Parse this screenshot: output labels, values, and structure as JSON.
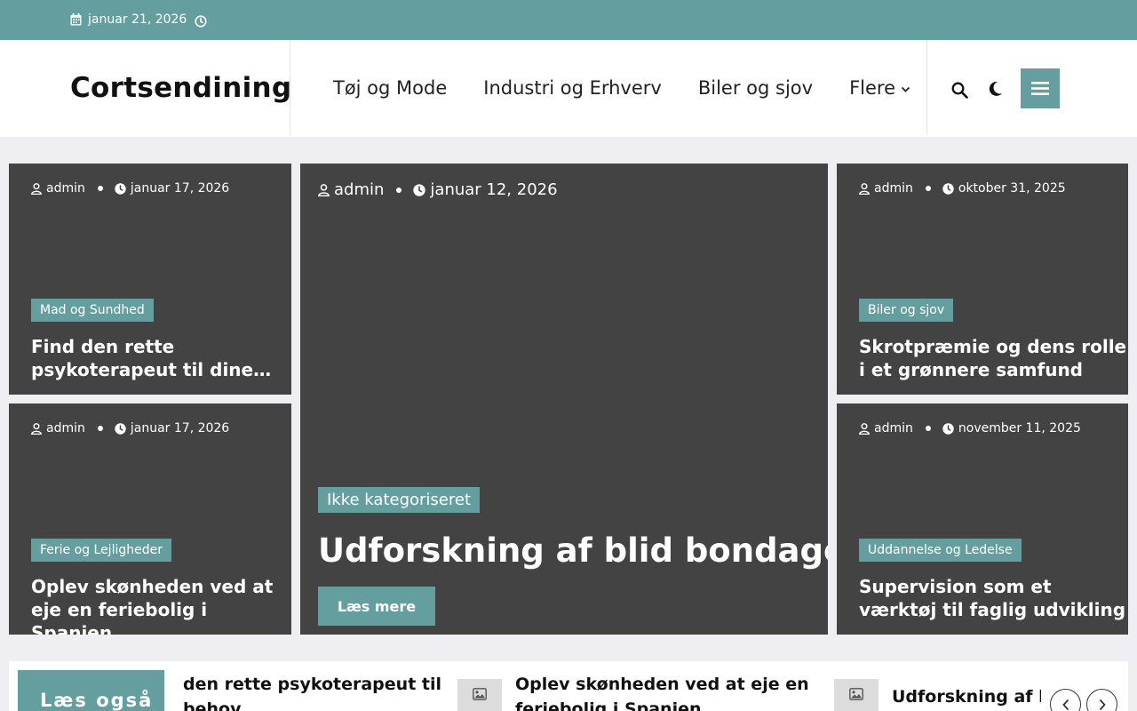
{
  "topbar": {
    "date": "januar 21, 2026"
  },
  "header": {
    "logo": "Cortsendining",
    "nav": [
      "Tøj og Mode",
      "Industri og Erhverv",
      "Biler og sjov",
      "Flere"
    ]
  },
  "cards": {
    "top_left": {
      "author": "admin",
      "date": "januar 17, 2026",
      "category": "Mad og Sundhed",
      "title_line1": "Find den rette",
      "title_line2": "psykoterapeut til dine…"
    },
    "bottom_left": {
      "author": "admin",
      "date": "januar 17, 2026",
      "category": "Ferie og Lejligheder",
      "title_line1": "Oplev skønheden ved at",
      "title_line2": "eje en feriebolig i Spanien"
    },
    "featured": {
      "author": "admin",
      "date": "januar 12, 2026",
      "category": "Ikke kategoriseret",
      "title": "Udforskning af blid bondage",
      "read_more": "Læs mere"
    },
    "top_right": {
      "author": "admin",
      "date": "oktober 31, 2025",
      "category": "Biler og sjov",
      "title_line1": "Skrotpræmie og dens rolle",
      "title_line2": "i et grønnere samfund"
    },
    "bottom_right": {
      "author": "admin",
      "date": "november 11, 2025",
      "category": "Uddannelse og Ledelse",
      "title_line1": "Supervision som et",
      "title_line2": "værktøj til faglig udvikling"
    }
  },
  "also_read": {
    "label": "Læs også",
    "items": [
      {
        "line1": "den rette psykoterapeut til",
        "line2": "behov"
      },
      {
        "line1": "Oplev skønheden ved at eje en",
        "line2": "feriebolig i Spanien"
      },
      {
        "line1": "Udforskning af bli",
        "line2": ""
      }
    ]
  },
  "colors": {
    "accent": "#659e9f",
    "card_bg": "#434343",
    "page_bg": "#eeeef3"
  }
}
